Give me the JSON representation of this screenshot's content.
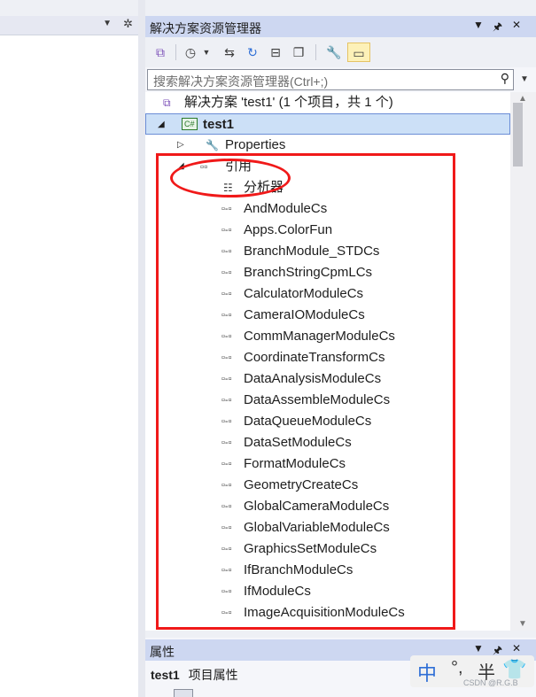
{
  "solution_explorer": {
    "title": "解决方案资源管理器",
    "search_placeholder": "搜索解决方案资源管理器(Ctrl+;)",
    "tree": {
      "solution_label": "解决方案 'test1' (1 个项目，共 1 个)",
      "project_label": "test1",
      "project_badge": "C#",
      "properties_label": "Properties",
      "references_label": "引用",
      "analyzer_label": "分析器",
      "references": [
        "AndModuleCs",
        "Apps.ColorFun",
        "BranchModule_STDCs",
        "BranchStringCpmLCs",
        "CalculatorModuleCs",
        "CameraIOModuleCs",
        "CommManagerModuleCs",
        "CoordinateTransformCs",
        "DataAnalysisModuleCs",
        "DataAssembleModuleCs",
        "DataQueueModuleCs",
        "DataSetModuleCs",
        "FormatModuleCs",
        "GeometryCreateCs",
        "GlobalCameraModuleCs",
        "GlobalVariableModuleCs",
        "GraphicsSetModuleCs",
        "IfBranchModuleCs",
        "IfModuleCs",
        "ImageAcquisitionModuleCs"
      ]
    },
    "annotation_color": "#f01919"
  },
  "properties_pane": {
    "title": "属性",
    "object_name": "test1",
    "object_type": "项目属性"
  },
  "ime": {
    "mode": "中",
    "punct": "°,",
    "width": "半"
  },
  "watermark": "CSDN @R.G.B"
}
